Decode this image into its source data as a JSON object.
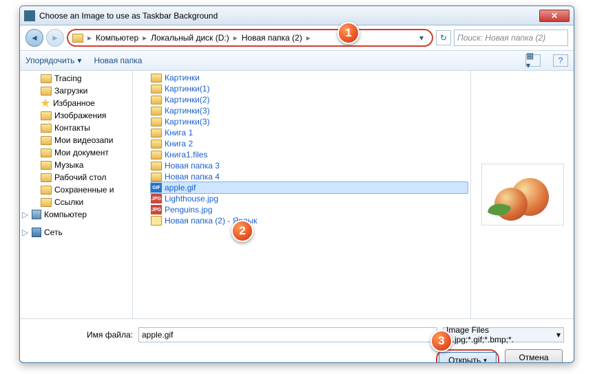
{
  "title": "Choose an Image to use as Taskbar Background",
  "breadcrumb": {
    "b1": "Компьютер",
    "b2": "Локальный диск (D:)",
    "b3": "Новая папка (2)"
  },
  "search_placeholder": "Поиск: Новая папка (2)",
  "toolbar": {
    "organize": "Упорядочить",
    "newfolder": "Новая папка"
  },
  "tree": {
    "tracing": "Tracing",
    "downloads": "Загрузки",
    "favorites": "Избранное",
    "pictures": "Изображения",
    "contacts": "Контакты",
    "videos": "Мои видеозапи",
    "documents": "Мои документ",
    "music": "Музыка",
    "desktop": "Рабочий стол",
    "saved": "Сохраненные и",
    "links": "Ссылки",
    "computer": "Компьютер",
    "network": "Сеть"
  },
  "files": {
    "f1": "Картинки",
    "f2": "Картинки(1)",
    "f3": "Картинки(2)",
    "f4": "Картинки(3)",
    "f5": "Картинки(3)",
    "f6": "Книга 1",
    "f7": "Книга 2",
    "f8": "Книга1.files",
    "f9": "Новая папка 3",
    "f10": "Новая папка 4",
    "f11": "apple.gif",
    "f12": "Lighthouse.jpg",
    "f13": "Penguins.jpg",
    "f14": "Новая папка (2) - Ярлык"
  },
  "filename_label": "Имя файла:",
  "filename_value": "apple.gif",
  "filter_label": "Image Files (*.jpg;*.gif;*.bmp;*.",
  "open_btn": "Открыть",
  "cancel_btn": "Отмена",
  "callouts": {
    "c1": "1",
    "c2": "2",
    "c3": "3"
  },
  "icons": {
    "gif": "GIF",
    "jpg": "JPG"
  }
}
